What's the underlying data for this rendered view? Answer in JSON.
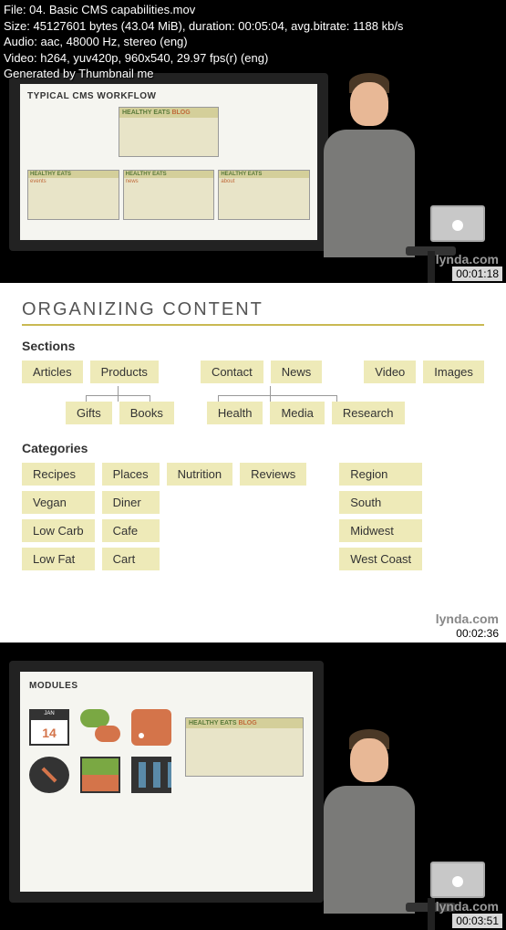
{
  "meta": {
    "file_line": "File: 04. Basic CMS capabilities.mov",
    "size_line": "Size: 45127601 bytes (43.04 MiB), duration: 00:05:04, avg.bitrate: 1188 kb/s",
    "audio_line": "Audio: aac, 48000 Hz, stereo (eng)",
    "video_line": "Video: h264, yuv420p, 960x540, 29.97 fps(r) (eng)",
    "generated_line": "Generated by Thumbnail me"
  },
  "frames": {
    "f1": {
      "timestamp": "00:01:18",
      "watermark": "lynda.com",
      "board_title": "TYPICAL CMS WORKFLOW",
      "site_brand": "HEALTHY EATS",
      "site_brand_suffix": "BLOG",
      "nodes": [
        "events",
        "news",
        "about"
      ]
    },
    "f2": {
      "timestamp": "00:02:36",
      "watermark": "lynda.com",
      "title": "ORGANIZING CONTENT",
      "sections_label": "Sections",
      "categories_label": "Categories",
      "sections_top": [
        "Articles",
        "Products",
        "Contact",
        "News",
        "Video",
        "Images"
      ],
      "sections_children_left": [
        "Gifts",
        "Books"
      ],
      "sections_children_right": [
        "Health",
        "Media",
        "Research"
      ],
      "categories": {
        "col1": [
          "Recipes",
          "Vegan",
          "Low Carb",
          "Low Fat"
        ],
        "col2": [
          "Places",
          "Diner",
          "Cafe",
          "Cart"
        ],
        "col3": [
          "Nutrition"
        ],
        "col4": [
          "Reviews"
        ],
        "col5": [
          "Region",
          "South",
          "Midwest",
          "West Coast"
        ]
      }
    },
    "f3": {
      "timestamp": "00:03:51",
      "watermark": "lynda.com",
      "board_title": "MODULES",
      "calendar_month": "JAN",
      "calendar_day": "14",
      "preview_brand": "HEALTHY EATS",
      "preview_suffix": "BLOG"
    }
  }
}
